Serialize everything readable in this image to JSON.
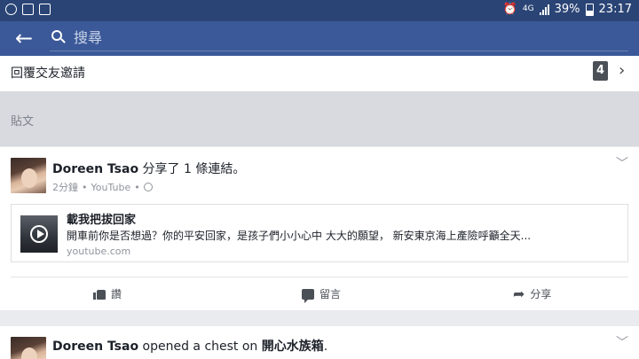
{
  "status_bar": {
    "network": "4G",
    "battery": "39%",
    "time": "23:17"
  },
  "search": {
    "placeholder": "搜尋"
  },
  "friend_requests": {
    "label": "回覆交友邀請",
    "count": "4"
  },
  "section": {
    "title": "貼文"
  },
  "posts": [
    {
      "author": "Doreen Tsao",
      "action": " 分享了 1 條連結。",
      "time": "2分鐘",
      "source": "YouTube",
      "link": {
        "title": "載我把拔回家",
        "description": "開車前你是否想過？你的平安回家，是孩子們小小心中 大大的願望， 新安東京海上產險呼籲全天...",
        "domain": "youtube.com"
      },
      "actions": {
        "like": "讚",
        "comment": "留言",
        "share": "分享"
      }
    },
    {
      "author": "Doreen Tsao",
      "action": " opened a chest on ",
      "target": "開心水族箱",
      "suffix": "."
    }
  ]
}
